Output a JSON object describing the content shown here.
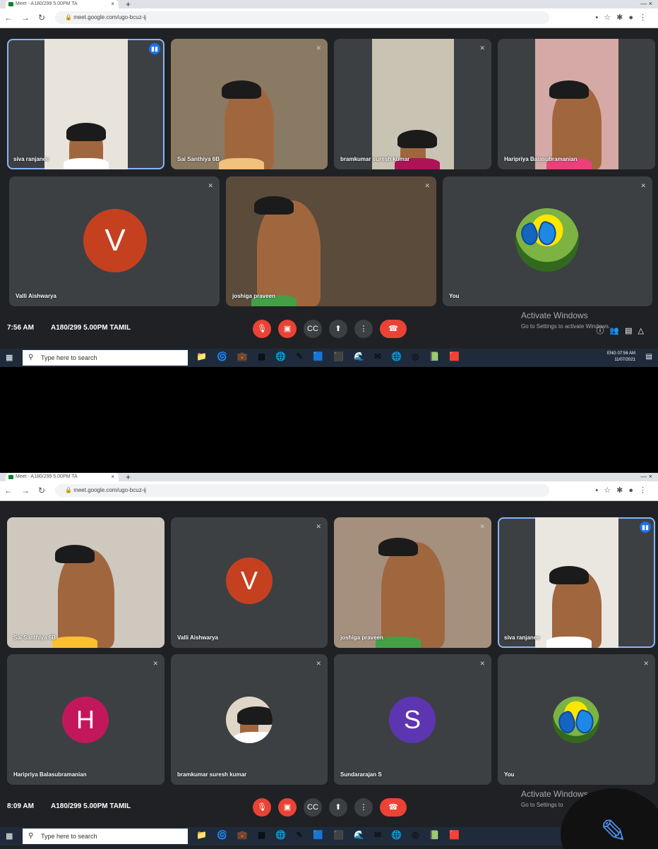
{
  "screens": [
    {
      "browser": {
        "tab_title": "Meet - A180/299 5.00PM TA",
        "tab_close": "×",
        "new_tab": "+",
        "url": "meet.google.com/ugo-bcuz-ij",
        "window_controls": "—  ×"
      },
      "tiles": [
        {
          "name": "siva ranjanee",
          "bg": "#e8e4dc",
          "speaking": true
        },
        {
          "name": "Sai Santhiya 6B",
          "bg": "#8a7a63"
        },
        {
          "name": "bramkumar suresh kumar",
          "bg": "#c9c3b3"
        },
        {
          "name": "Haripriya Balasubramanian",
          "bg": "#d5a9a6"
        },
        {
          "name": "Valli Aishwarya",
          "initial": "V",
          "avatar_color": "#c5401f"
        },
        {
          "name": "joshiga praveen",
          "bg": "#5b4b3b"
        },
        {
          "name": "You",
          "avatar": "butterfly"
        }
      ],
      "bottom": {
        "time": "7:56 AM",
        "title": "A180/299 5.00PM TAMIL"
      },
      "watermark": {
        "line1": "Activate Windows",
        "line2": "Go to Settings to activate Windows."
      },
      "taskbar": {
        "search": "Type here to search",
        "lang": "ENG",
        "time": "07:56 AM",
        "date": "11/07/2021"
      }
    },
    {
      "browser": {
        "tab_title": "Meet - A180/299 5.00PM TA",
        "tab_close": "×",
        "new_tab": "+",
        "url": "meet.google.com/ugo-bcuz-ij",
        "window_controls": "—  ×"
      },
      "tiles": [
        {
          "name": "Sai Santhiya 6B",
          "bg": "#cfc8bf"
        },
        {
          "name": "Valli Aishwarya",
          "initial": "V",
          "avatar_color": "#c5401f"
        },
        {
          "name": "joshiga praveen",
          "bg": "#a58f7d"
        },
        {
          "name": "siva ranjanee",
          "bg": "#eae6e0",
          "speaking": true
        },
        {
          "name": "Haripriya Balasubramanian",
          "initial": "H",
          "avatar_color": "#c2185b"
        },
        {
          "name": "bramkumar suresh kumar",
          "avatar": "photo"
        },
        {
          "name": "Sundararajan S",
          "initial": "S",
          "avatar_color": "#5e35b1"
        },
        {
          "name": "You",
          "avatar": "butterfly"
        }
      ],
      "bottom": {
        "time": "8:09 AM",
        "title": "A180/299 5.00PM TAMIL"
      },
      "watermark": {
        "line1": "Activate Windows",
        "line2": "Go to Settings to"
      },
      "taskbar": {
        "search": "Type here to search"
      }
    }
  ]
}
